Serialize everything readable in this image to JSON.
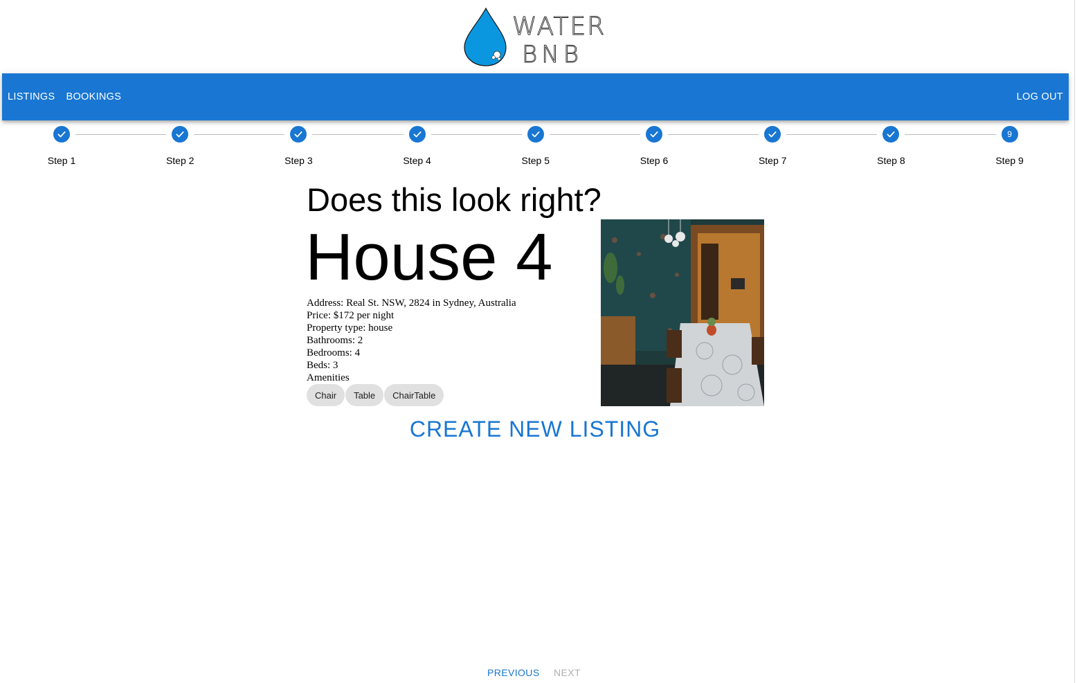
{
  "brand": {
    "logo_text_line1": "WATER",
    "logo_text_line2": "BNB",
    "drop_color": "#0a97e0"
  },
  "navbar": {
    "bg_color": "#1976d2",
    "left_items": [
      {
        "label": "LISTINGS"
      },
      {
        "label": "BOOKINGS"
      }
    ],
    "logout_label": "LOG OUT"
  },
  "stepper": {
    "steps": [
      {
        "label": "Step 1",
        "state": "completed",
        "icon": "check-icon"
      },
      {
        "label": "Step 2",
        "state": "completed",
        "icon": "check-icon"
      },
      {
        "label": "Step 3",
        "state": "completed",
        "icon": "check-icon"
      },
      {
        "label": "Step 4",
        "state": "completed",
        "icon": "check-icon"
      },
      {
        "label": "Step 5",
        "state": "completed",
        "icon": "check-icon"
      },
      {
        "label": "Step 6",
        "state": "completed",
        "icon": "check-icon"
      },
      {
        "label": "Step 7",
        "state": "completed",
        "icon": "check-icon"
      },
      {
        "label": "Step 8",
        "state": "completed",
        "icon": "check-icon"
      },
      {
        "label": "Step 9",
        "state": "active",
        "number": "9"
      }
    ]
  },
  "review": {
    "question": "Does this look right?",
    "title": "House 4",
    "details": [
      "Address: Real St. NSW, 2824 in Sydney, Australia",
      "Price: $172 per night",
      "Property type: house",
      "Bathrooms: 2",
      "Bedrooms: 4",
      "Beds: 3",
      "Amenities"
    ],
    "amenities": [
      "Chair",
      "Table",
      "ChairTable"
    ]
  },
  "actions": {
    "create_label": "CREATE NEW LISTING",
    "previous_label": "PREVIOUS",
    "next_label": "NEXT"
  }
}
